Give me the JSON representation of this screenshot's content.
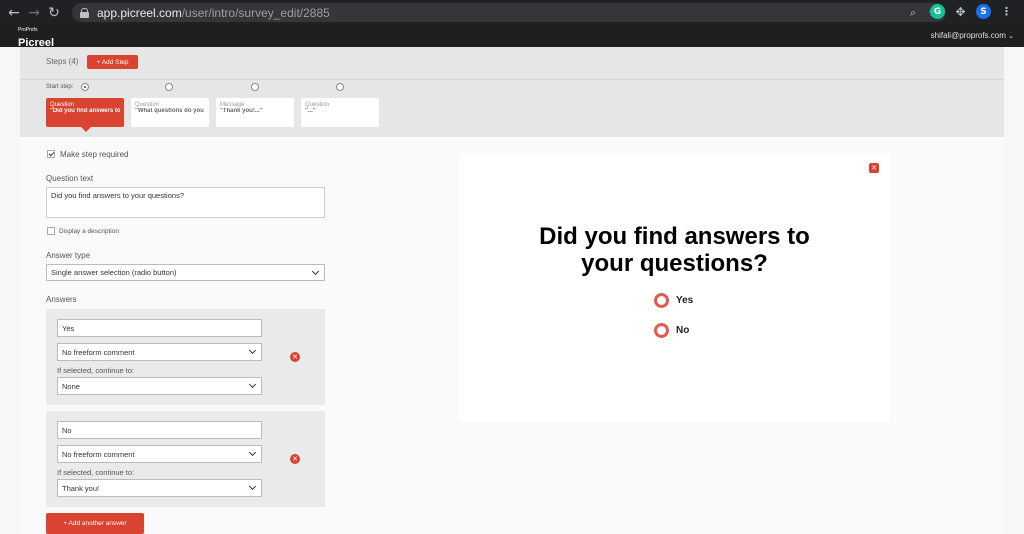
{
  "browser": {
    "url_host": "app.picreel.com",
    "url_path": "/user/intro/survey_edit/2885",
    "ext_grammarly": "G",
    "profile": "S"
  },
  "app": {
    "logo_small": "ProProfs",
    "logo": "Picreel",
    "user_email": "shifali@proprofs.com"
  },
  "steps": {
    "label": "Steps (4)",
    "add_label": "+ Add Step",
    "start_step_label": "Start step:",
    "cards": [
      {
        "type": "Question",
        "title": "\"Did you find answers to",
        "active": true
      },
      {
        "type": "Question",
        "title": "\"What questions do you",
        "active": false
      },
      {
        "type": "Message",
        "title": "\"Thank you!...\"",
        "active": false
      },
      {
        "type": "Question",
        "title": "\"...\"",
        "active": false
      }
    ]
  },
  "form": {
    "required_label": "Make step required",
    "question_text_label": "Question text",
    "question_text": "Did you find answers to your questions?",
    "display_description_label": "Display a description",
    "answer_type_label": "Answer type",
    "answer_type_value": "Single answer selection (radio button)",
    "answers_label": "Answers",
    "answers": [
      {
        "text": "Yes",
        "comment": "No freeform comment",
        "continue_label": "If selected, continue to:",
        "continue_to": "None"
      },
      {
        "text": "No",
        "comment": "No freeform comment",
        "continue_label": "If selected, continue to:",
        "continue_to": "Thank you!"
      }
    ],
    "add_answer_label": "+ Add another answer"
  },
  "preview": {
    "question_line1": "Did you find answers to",
    "question_line2": "your questions?",
    "options": [
      "Yes",
      "No"
    ]
  },
  "colors": {
    "accent": "#d9432f",
    "radio": "#e05a4f"
  }
}
